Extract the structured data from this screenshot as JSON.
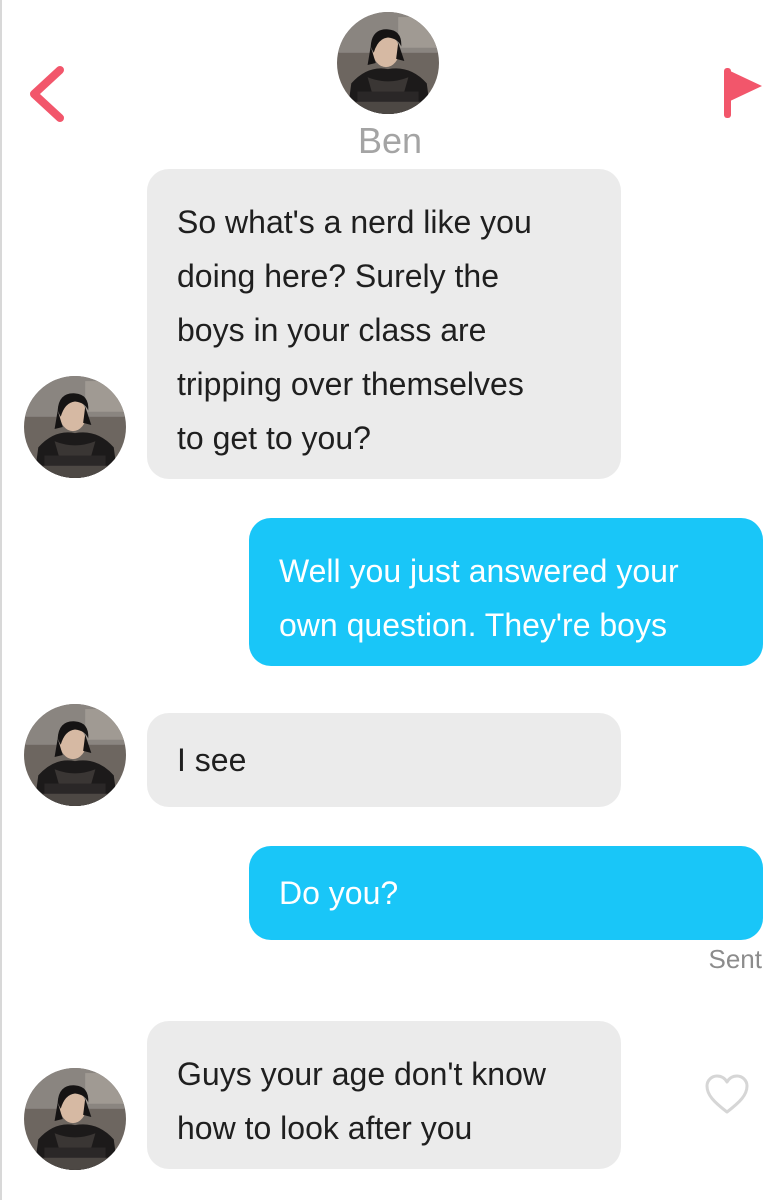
{
  "header": {
    "contact_name": "Ben",
    "back_icon": "chevron-left-icon",
    "report_icon": "flag-icon",
    "accent_color": "#f2566b"
  },
  "messages": [
    {
      "direction": "incoming",
      "lines": [
        "So what's a nerd like you",
        "doing here? Surely the",
        "boys in your class are",
        "tripping over themselves",
        "to get to you?"
      ]
    },
    {
      "direction": "outgoing",
      "lines": [
        "Well you just answered your",
        "own question. They're boys"
      ]
    },
    {
      "direction": "incoming",
      "lines": [
        "I see"
      ]
    },
    {
      "direction": "outgoing",
      "lines": [
        "Do you?"
      ],
      "status": "Sent"
    },
    {
      "direction": "incoming",
      "lines": [
        "Guys your age don't know",
        "how to look after you"
      ],
      "like_icon": "heart-outline-icon"
    }
  ],
  "colors": {
    "incoming_bubble": "#ebebeb",
    "outgoing_bubble": "#19c6f8",
    "name_text": "#a4a4a4"
  }
}
